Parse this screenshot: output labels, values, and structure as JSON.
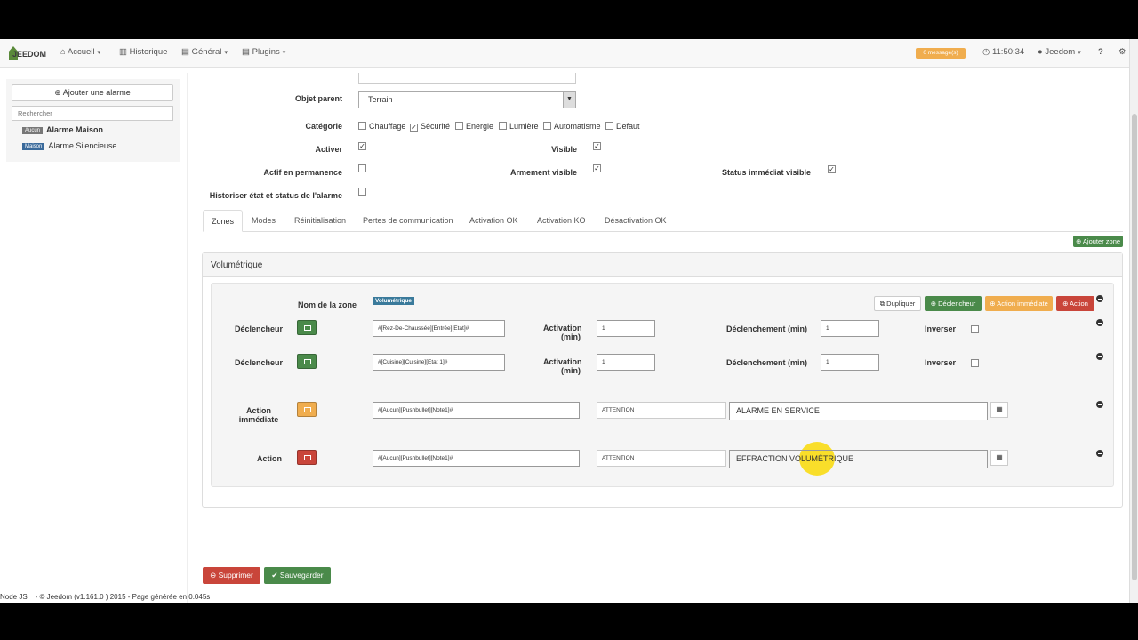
{
  "navbar": {
    "logo_text": "JEEDOM",
    "menu": [
      {
        "label": "Accueil",
        "icon": "home-icon"
      },
      {
        "label": "Historique",
        "icon": "chart-icon"
      },
      {
        "label": "Général",
        "icon": "list-icon"
      },
      {
        "label": "Plugins",
        "icon": "tasks-icon"
      }
    ],
    "message_badge": "0 message(s)",
    "time": "11:50:34",
    "user": "Jeedom",
    "help": "?"
  },
  "sidebar": {
    "add_button": "Ajouter une alarme",
    "search_placeholder": "Rechercher",
    "items": [
      {
        "tag": "Aucun",
        "label": "Alarme Maison"
      },
      {
        "tag": "Maison",
        "label": "Alarme Silencieuse"
      }
    ]
  },
  "form": {
    "parent_label": "Objet parent",
    "parent_value": "Terrain",
    "category_label": "Catégorie",
    "categories": [
      {
        "label": "Chauffage",
        "checked": false
      },
      {
        "label": "Sécurité",
        "checked": true
      },
      {
        "label": "Energie",
        "checked": false
      },
      {
        "label": "Lumière",
        "checked": false
      },
      {
        "label": "Automatisme",
        "checked": false
      },
      {
        "label": "Defaut",
        "checked": false
      }
    ],
    "activer_label": "Activer",
    "visible_label": "Visible",
    "permanent_label": "Actif en permanence",
    "armement_label": "Armement visible",
    "status_label": "Status immédiat visible",
    "historiser_label": "Historiser état et status de l'alarme"
  },
  "tabs": [
    "Zones",
    "Modes",
    "Réinitialisation",
    "Pertes de communication",
    "Activation OK",
    "Activation KO",
    "Désactivation OK"
  ],
  "add_zone_button": "Ajouter zone",
  "zone": {
    "title": "Volumétrique",
    "name_label": "Nom de la zone",
    "name_value": "Volumétrique",
    "buttons": {
      "dupliquer": "Dupliquer",
      "declencheur": "Déclencheur",
      "action_immediate": "Action immédiate",
      "action": "Action"
    },
    "triggers": [
      {
        "label": "Déclencheur",
        "cmd": "#[Rez-De-Chaussée][Entrée][Etat]#",
        "activation_label": "Activation",
        "activation_unit": "(min)",
        "activation": "1",
        "declenchement_label": "Déclenchement (min)",
        "declenchement": "1",
        "inverser_label": "Inverser"
      },
      {
        "label": "Déclencheur",
        "cmd": "#[Cuisine][Cuisine][Etat 1]#",
        "activation_label": "Activation",
        "activation_unit": "(min)",
        "activation": "1",
        "declenchement_label": "Déclenchement (min)",
        "declenchement": "1",
        "inverser_label": "Inverser"
      }
    ],
    "actions": [
      {
        "label_line1": "Action",
        "label_line2": "immédiate",
        "cmd": "#[Aucun][Pushbullet][Note1]#",
        "title": "ATTENTION",
        "message": "ALARME EN SERVICE"
      },
      {
        "label_line1": "Action",
        "label_line2": "",
        "cmd": "#[Aucun][Pushbullet][Note1]#",
        "title": "ATTENTION",
        "message": "EFFRACTION VOLUMÉTRIQUE"
      }
    ]
  },
  "bottom_buttons": {
    "supprimer": "Supprimer",
    "sauvegarder": "Sauvegarder"
  },
  "footer": "Node JS    - © Jeedom (v1.161.0 ) 2015 - Page générée en 0.045s",
  "colors": {
    "success": "#4a8a4a",
    "warning": "#f0ad4e",
    "danger": "#c9453a",
    "info": "#4a7a9b"
  }
}
